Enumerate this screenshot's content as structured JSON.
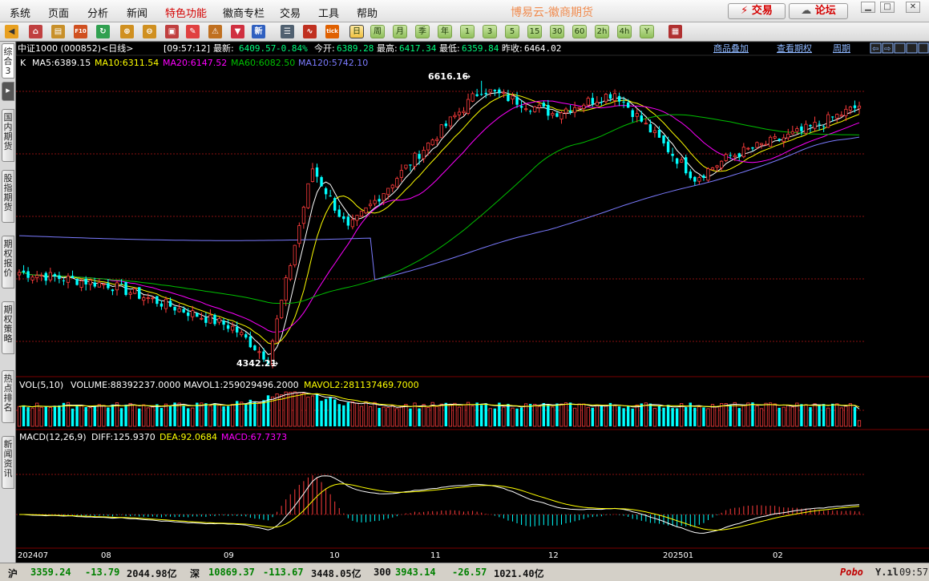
{
  "menu": {
    "items": [
      "系统",
      "页面",
      "分析",
      "新闻",
      "特色功能",
      "徽商专栏",
      "交易",
      "工具",
      "帮助"
    ],
    "title": "博易云-徽商期货",
    "trade_button": "交易",
    "forum_button": "论坛",
    "window_controls": [
      "□",
      "▭",
      "✕"
    ]
  },
  "toolbar": {
    "period_buttons": [
      "日",
      "周",
      "月",
      "季",
      "年",
      "1",
      "3",
      "5",
      "15",
      "30",
      "60",
      "2h",
      "4h",
      "Y"
    ],
    "selected_period": "日",
    "news_label": "新",
    "tick_label": "tick",
    "f10_label": "F10"
  },
  "sidebar": {
    "tabs": [
      "综合3",
      "国内期货",
      "股指期货",
      "期权报价",
      "期权策略",
      "热点排名",
      "新闻资讯"
    ],
    "active": "综合3"
  },
  "quote": {
    "name": "中证1000 (000852)<日线>",
    "time": "[09:57:12]",
    "latest_label": "最新:",
    "latest": "6409.57",
    "change_pct": "-0.84%",
    "open_label": "今开:",
    "open": "6389.28",
    "high_label": "最高:",
    "high": "6417.34",
    "low_label": "最低:",
    "low": "6359.84",
    "prev_label": "昨收:",
    "prev": "6464.02",
    "links": [
      "商品叠加",
      "查看期权",
      "周期"
    ],
    "nav_icons": [
      "⇦",
      "⇨",
      "⊟",
      "⊞",
      "⊡"
    ]
  },
  "colors": {
    "up": "#ff3c3c",
    "down": "#00ffff",
    "ma5": "#ffffff",
    "ma10": "#ffff00",
    "ma20": "#ff00ff",
    "ma60": "#00c000",
    "ma120": "#7b7bff",
    "grid": "#8a1010",
    "axis_text": "#ffffff"
  },
  "indicators": {
    "price": {
      "label": "K",
      "ma5": "MA5:6389.15",
      "ma10": "MA10:6311.54",
      "ma20": "MA20:6147.52",
      "ma60": "MA60:6082.50",
      "ma120": "MA120:5742.10"
    },
    "volume": {
      "title": "VOL(5,10)",
      "volume": "VOLUME:88392237.0000",
      "mavol1": "MAVOL1:259029496.2000",
      "mavol2": "MAVOL2:281137469.7000"
    },
    "macd": {
      "title": "MACD(12,26,9)",
      "diff": "DIFF:125.9370",
      "dea": "DEA:92.0684",
      "macd": "MACD:67.7373"
    }
  },
  "annotations": {
    "high_mark": "6616.16",
    "low_mark": "4342.21"
  },
  "x_axis": {
    "labels": [
      "202407",
      "08",
      "09",
      "10",
      "11",
      "12",
      "202501",
      "02"
    ]
  },
  "chart_data": {
    "type": "candlestick",
    "title": "中证1000 (000852)<日线>",
    "dates": [
      "202407",
      "08",
      "09",
      "10",
      "11",
      "12",
      "202501",
      "02"
    ],
    "high": 6616.16,
    "low": 4342.21,
    "latest_close": 6409.57,
    "ma": {
      "ma5": 6389.15,
      "ma10": 6311.54,
      "ma20": 6147.52,
      "ma60": 6082.5,
      "ma120": 5742.1
    },
    "trend_anchors": [
      {
        "x": "202407",
        "close": 5050
      },
      {
        "x": "08",
        "close": 4950
      },
      {
        "x": "09",
        "close": 4600
      },
      {
        "x": "09-mid",
        "close": 4342
      },
      {
        "x": "10",
        "close": 5900
      },
      {
        "x": "10-mid",
        "close": 5400
      },
      {
        "x": "11",
        "close": 6100
      },
      {
        "x": "11-mid",
        "close": 6550
      },
      {
        "x": "12",
        "close": 6350
      },
      {
        "x": "12-mid",
        "close": 6520
      },
      {
        "x": "202501",
        "close": 5820
      },
      {
        "x": "202501-mid",
        "close": 6000
      },
      {
        "x": "02",
        "close": 6200
      },
      {
        "x": "latest",
        "close": 6409
      }
    ],
    "volume": {
      "latest": 88392237,
      "mavol1": 259029496.2,
      "mavol2": 281137469.7
    },
    "macd": {
      "diff": 125.937,
      "dea": 92.0684,
      "macd": 67.7373
    }
  },
  "status": {
    "sh_label": "沪",
    "sh_value": "3359.24",
    "sh_change": "-13.79",
    "sh_amount": "2044.98亿",
    "sz_label": "深",
    "sz_value": "10869.37",
    "sz_change": "-113.67",
    "sz_amount": "3448.05亿",
    "c300_label": "300",
    "c300_value": "3943.14",
    "c300_change": "-26.57",
    "c300_amount": "1021.40亿",
    "brand": "Pobo",
    "clock": "09:57"
  }
}
